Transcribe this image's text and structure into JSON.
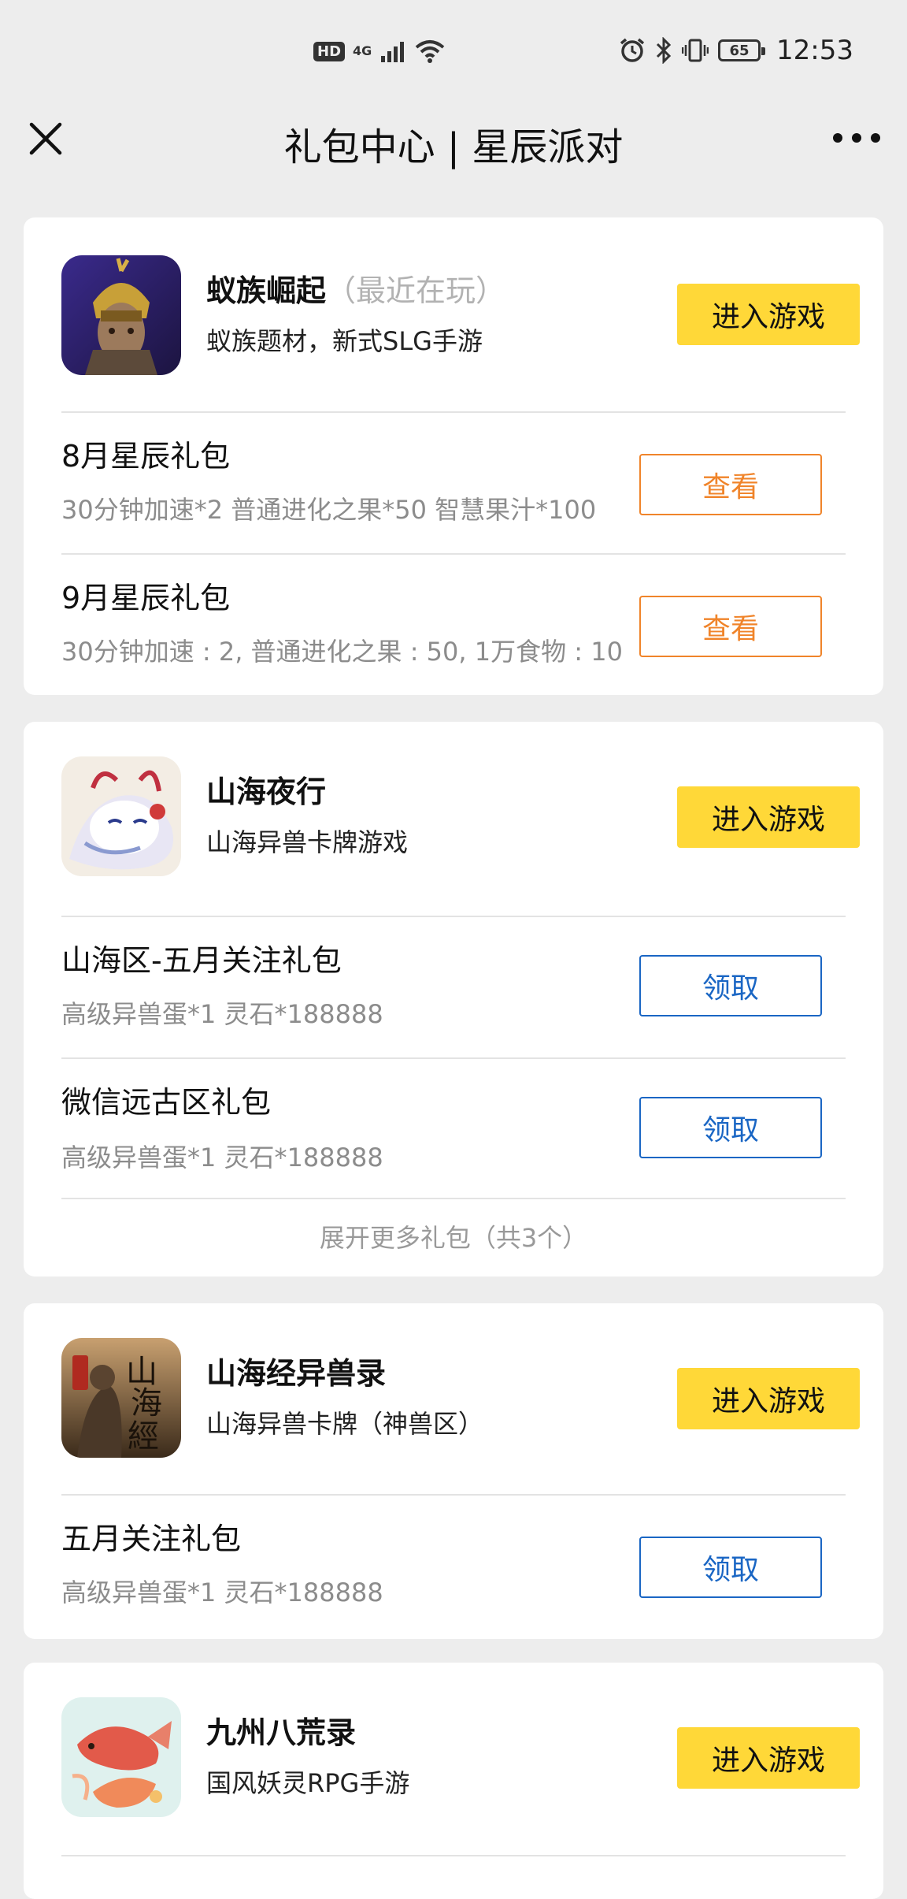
{
  "status_bar": {
    "hd": "HD",
    "network": "4G",
    "battery": "65",
    "time": "12:53"
  },
  "nav": {
    "title": "礼包中心 | 星辰派对"
  },
  "games": [
    {
      "name": "蚁族崛起",
      "tag": "（最近在玩）",
      "desc": "蚁族题材，新式SLG手游",
      "enter_label": "进入游戏",
      "icon": "ant-warrior-icon",
      "gifts": [
        {
          "title": "8月星辰礼包",
          "desc": "30分钟加速*2 普通进化之果*50 智慧果汁*100",
          "action": "查看"
        },
        {
          "title": "9月星辰礼包",
          "desc": "30分钟加速 : 2, 普通进化之果 : 50, 1万食物 : 10",
          "action": "查看"
        }
      ]
    },
    {
      "name": "山海夜行",
      "desc": "山海异兽卡牌游戏",
      "enter_label": "进入游戏",
      "icon": "mythic-beast-icon",
      "gifts": [
        {
          "title": "山海区-五月关注礼包",
          "desc": "高级异兽蛋*1 灵石*188888",
          "action": "领取"
        },
        {
          "title": "微信远古区礼包",
          "desc": "高级异兽蛋*1 灵石*188888",
          "action": "领取"
        }
      ],
      "expand": "展开更多礼包（共3个）"
    },
    {
      "name": "山海经异兽录",
      "desc": "山海异兽卡牌（神兽区）",
      "enter_label": "进入游戏",
      "icon": "shanhaijing-logo-icon",
      "icon_text": "山海經",
      "gifts": [
        {
          "title": "五月关注礼包",
          "desc": "高级异兽蛋*1 灵石*188888",
          "action": "领取"
        }
      ]
    },
    {
      "name": "九州八荒录",
      "desc": "国风妖灵RPG手游",
      "enter_label": "进入游戏",
      "icon": "koi-fish-icon"
    }
  ],
  "colors": {
    "background": "#ededed",
    "card": "#ffffff",
    "enter_button": "#ffd838",
    "view_button": "#f0842a",
    "claim_button": "#1a66c4"
  }
}
